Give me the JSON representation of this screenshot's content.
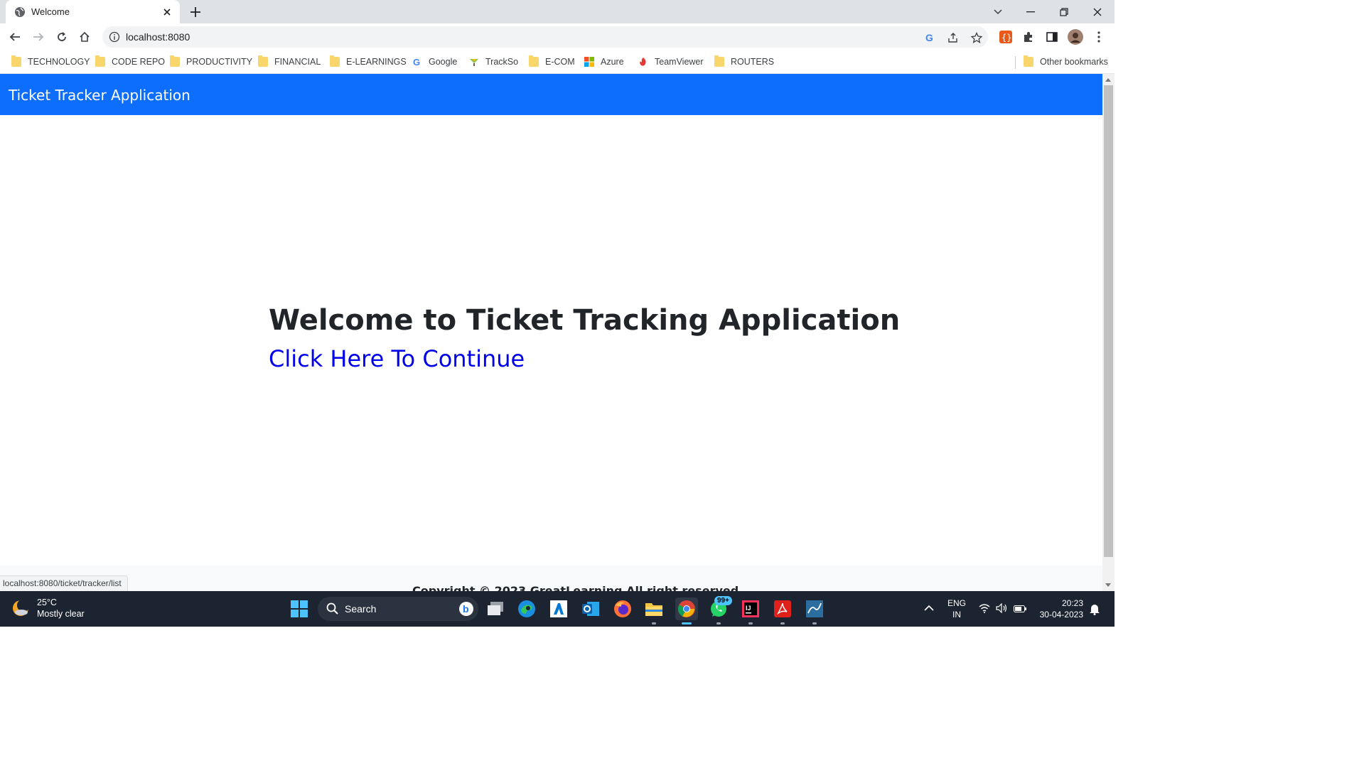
{
  "browser": {
    "tab_title": "Welcome",
    "url": "localhost:8080",
    "status_url": "localhost:8080/ticket/tracker/list"
  },
  "bookmarks": {
    "items": [
      {
        "label": "TECHNOLOGY",
        "icon": "folder-icon"
      },
      {
        "label": "CODE REPO",
        "icon": "folder-icon"
      },
      {
        "label": "PRODUCTIVITY",
        "icon": "folder-icon"
      },
      {
        "label": "FINANCIAL",
        "icon": "folder-icon"
      },
      {
        "label": "E-LEARNINGS",
        "icon": "folder-icon"
      },
      {
        "label": "Google",
        "icon": "google-icon"
      },
      {
        "label": "TrackSo",
        "icon": "trackso-icon"
      },
      {
        "label": "E-COM",
        "icon": "folder-icon"
      },
      {
        "label": "Azure",
        "icon": "microsoft-icon"
      },
      {
        "label": "TeamViewer",
        "icon": "teamviewer-icon"
      },
      {
        "label": "ROUTERS",
        "icon": "folder-icon"
      }
    ],
    "other": "Other bookmarks"
  },
  "app": {
    "brand": "Ticket Tracker Application",
    "heading": "Welcome to Ticket Tracking Application",
    "continue_link": "Click Here To Continue",
    "footer": "Copyright © 2023 GreatLearning All right reserved"
  },
  "taskbar": {
    "weather_temp": "25°C",
    "weather_desc": "Mostly clear",
    "search_label": "Search",
    "whatsapp_badge": "99+",
    "lang_top": "ENG",
    "lang_bottom": "IN",
    "time": "20:23",
    "date": "30-04-2023"
  },
  "colors": {
    "navbar": "#0d6efd",
    "link": "#0000ee",
    "taskbar": "#1c2331"
  }
}
